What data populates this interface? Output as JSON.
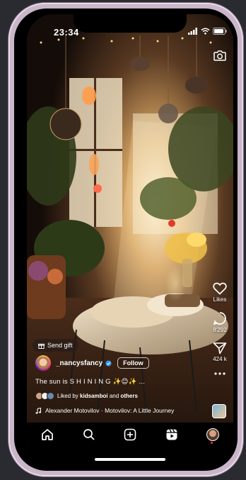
{
  "status_bar": {
    "time": "23:34"
  },
  "reel": {
    "send_gift_label": "Send gift",
    "author": {
      "username": "_nancysfancy",
      "follow_label": "Follow"
    },
    "caption": "The sun is S H I N I N G ✨😊✨ ...",
    "liked_by": {
      "prefix": "Liked by",
      "user": "kidsamboi",
      "joiner": "and",
      "others": "others"
    },
    "music": "Alexander Motovilov · Motovilov: A Little Journey"
  },
  "actions": {
    "likes_label": "Likes",
    "comments_count": "8'292",
    "shares_count": "424 k"
  },
  "icons": {
    "camera": "camera-icon",
    "like": "heart-icon",
    "comment": "comment-icon",
    "share": "send-icon",
    "more": "more-icon",
    "gift": "gift-icon",
    "verified": "verified-badge-icon",
    "music": "music-note-icon",
    "nav": [
      "home-icon",
      "search-icon",
      "create-icon",
      "reels-icon",
      "profile-avatar"
    ]
  },
  "colors": {
    "accent_verified": "#3897f0",
    "notification_dot": "#ff3040",
    "nav_background": "#000000"
  }
}
